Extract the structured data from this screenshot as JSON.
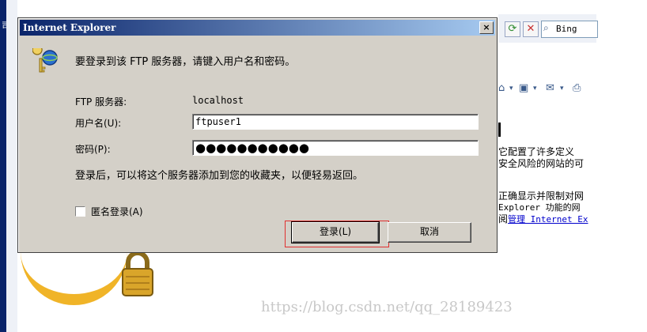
{
  "background": {
    "left_char": "司",
    "toolbar_search_text": "Bing",
    "text_lines": [
      "它配置了许多定义",
      "安全风险的网站的可",
      "正确显示并限制对网",
      "Explorer 功能的网",
      "阅"
    ],
    "link_text": "管理 Internet Ex",
    "watermark": "https://blog.csdn.net/qq_28189423"
  },
  "dialog": {
    "title": "Internet Explorer",
    "close_label": "×",
    "prompt": "要登录到该 FTP 服务器，请键入用户名和密码。",
    "server_label": "FTP 服务器:",
    "server_value": "localhost",
    "username_label": "用户名(U):",
    "username_value": "ftpuser1",
    "password_label": "密码(P):",
    "password_value": "●●●●●●●●●●●",
    "hint": "登录后，可以将这个服务器添加到您的收藏夹，以便轻易返回。",
    "anonymous_label": "匿名登录(A)",
    "login_button": "登录(L)",
    "cancel_button": "取消"
  },
  "colors": {
    "titlebar_start": "#0a246a",
    "titlebar_end": "#a6caf0",
    "dialog_face": "#d4d0c8",
    "focus_highlight": "#e03030"
  }
}
